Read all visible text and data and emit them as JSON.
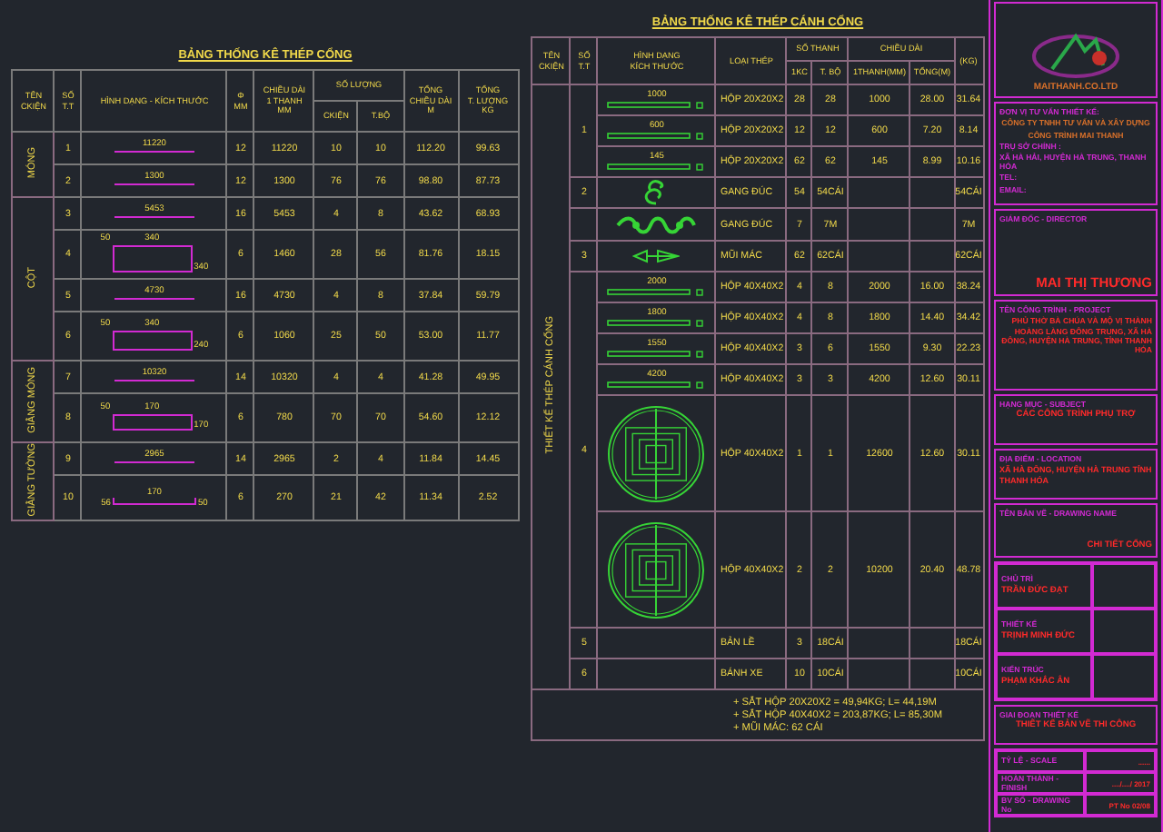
{
  "left_table": {
    "title": "BẢNG THỐNG KÊ THÉP CỔNG",
    "headers": {
      "name": "TÊN\nCKIỆN",
      "no": "SỐ\nT.T",
      "shape": "HÌNH DẠNG - KÍCH THƯỚC",
      "dia": "Φ\nMM",
      "length": "CHIỀU DÀI\n1 THANH\nMM",
      "qty": "SỐ LƯỢNG",
      "qty_part": "CKIỆN",
      "qty_total": "T.BỘ",
      "total_len": "TỔNG\nCHIỀU DÀI\nM",
      "weight": "TỔNG\nT. LƯỢNG\nKG"
    },
    "groups": [
      {
        "name": "MÓNG",
        "rows": [
          {
            "no": "1",
            "shape": {
              "kind": "bar",
              "dims": [
                "11220"
              ]
            },
            "dia": "12",
            "length": "11220",
            "part": "10",
            "total": "10",
            "total_len": "112.20",
            "weight": "99.63"
          },
          {
            "no": "2",
            "shape": {
              "kind": "bar",
              "dims": [
                "1300"
              ]
            },
            "dia": "12",
            "length": "1300",
            "part": "76",
            "total": "76",
            "total_len": "98.80",
            "weight": "87.73"
          }
        ]
      },
      {
        "name": "CỘT",
        "rows": [
          {
            "no": "3",
            "shape": {
              "kind": "bar",
              "dims": [
                "5453"
              ]
            },
            "dia": "16",
            "length": "5453",
            "part": "4",
            "total": "8",
            "total_len": "43.62",
            "weight": "68.93"
          },
          {
            "no": "4",
            "shape": {
              "kind": "stirrup",
              "dims": [
                "50",
                "340",
                "340"
              ]
            },
            "dia": "6",
            "length": "1460",
            "part": "28",
            "total": "56",
            "total_len": "81.76",
            "weight": "18.15"
          },
          {
            "no": "5",
            "shape": {
              "kind": "bar",
              "dims": [
                "4730"
              ]
            },
            "dia": "16",
            "length": "4730",
            "part": "4",
            "total": "8",
            "total_len": "37.84",
            "weight": "59.79"
          },
          {
            "no": "6",
            "shape": {
              "kind": "stirrup",
              "dims": [
                "50",
                "340",
                "240"
              ]
            },
            "dia": "6",
            "length": "1060",
            "part": "25",
            "total": "50",
            "total_len": "53.00",
            "weight": "11.77"
          }
        ]
      },
      {
        "name": "GIẰNG MÓNG",
        "rows": [
          {
            "no": "7",
            "shape": {
              "kind": "bar",
              "dims": [
                "10320"
              ]
            },
            "dia": "14",
            "length": "10320",
            "part": "4",
            "total": "4",
            "total_len": "41.28",
            "weight": "49.95"
          },
          {
            "no": "8",
            "shape": {
              "kind": "stirrup",
              "dims": [
                "50",
                "170",
                "170"
              ]
            },
            "dia": "6",
            "length": "780",
            "part": "70",
            "total": "70",
            "total_len": "54.60",
            "weight": "12.12"
          }
        ]
      },
      {
        "name": "GIẰNG TƯỜNG",
        "rows": [
          {
            "no": "9",
            "shape": {
              "kind": "bar",
              "dims": [
                "2965"
              ]
            },
            "dia": "14",
            "length": "2965",
            "part": "2",
            "total": "4",
            "total_len": "11.84",
            "weight": "14.45"
          },
          {
            "no": "10",
            "shape": {
              "kind": "hook",
              "dims": [
                "56",
                "170",
                "50"
              ]
            },
            "dia": "6",
            "length": "270",
            "part": "21",
            "total": "42",
            "total_len": "11.34",
            "weight": "2.52"
          }
        ]
      }
    ]
  },
  "gate_table": {
    "title": "BẢNG THỐNG KÊ THÉP CÁNH CỔNG",
    "headers": {
      "name": "TÊN\nCKIỆN",
      "no": "SỐ\nT.T",
      "shape": "HÌNH DẠNG\nKÍCH THƯỚC",
      "steel": "LOẠI THÉP",
      "count": "SỐ THANH",
      "count_part": "1KC",
      "count_total": "T. BỘ",
      "length": "CHIỀU DÀI",
      "length_one": "1THANH(MM)",
      "length_total": "TỔNG(M)",
      "weight": "(KG)"
    },
    "group_label": "THIẾT KẾ THÉP CÁNH CỔNG",
    "groups": [
      {
        "no": "1",
        "items": [
          {
            "shape": {
              "kind": "bar",
              "dims": [
                "1000"
              ]
            },
            "steel": "HỘP 20X20X2",
            "part": "28",
            "total": "28",
            "length": "1000",
            "total_m": "28.00",
            "weight": "31.64"
          },
          {
            "shape": {
              "kind": "bar",
              "dims": [
                "600"
              ]
            },
            "steel": "HỘP 20X20X2",
            "part": "12",
            "total": "12",
            "length": "600",
            "total_m": "7.20",
            "weight": "8.14"
          },
          {
            "shape": {
              "kind": "bar",
              "dims": [
                "145"
              ]
            },
            "steel": "HỘP 20X20X2",
            "part": "62",
            "total": "62",
            "length": "145",
            "total_m": "8.99",
            "weight": "10.16"
          }
        ]
      },
      {
        "no": "2",
        "items": [
          {
            "shape": {
              "kind": "swirl"
            },
            "steel": "GANG ĐÚC",
            "part": "54",
            "total": "54CÁI",
            "weight": "54CÁI"
          }
        ]
      },
      {
        "items": [
          {
            "shape": {
              "kind": "vine"
            },
            "steel": "GANG ĐÚC",
            "part": "7",
            "total": "7M",
            "weight": "7M"
          }
        ]
      },
      {
        "no": "3",
        "items": [
          {
            "shape": {
              "kind": "spear"
            },
            "steel": "MŨI MÁC",
            "part": "62",
            "total": "62CÁI",
            "weight": "62CÁI"
          }
        ]
      },
      {
        "no": "4",
        "items": [
          {
            "shape": {
              "kind": "bar",
              "dims": [
                "2000"
              ]
            },
            "steel": "HỘP 40X40X2",
            "part": "4",
            "total": "8",
            "length": "2000",
            "total_m": "16.00",
            "weight": "38.24"
          },
          {
            "shape": {
              "kind": "bar",
              "dims": [
                "1800"
              ]
            },
            "steel": "HỘP 40X40X2",
            "part": "4",
            "total": "8",
            "length": "1800",
            "total_m": "14.40",
            "weight": "34.42"
          },
          {
            "shape": {
              "kind": "bar",
              "dims": [
                "1550"
              ]
            },
            "steel": "HỘP 40X40X2",
            "part": "3",
            "total": "6",
            "length": "1550",
            "total_m": "9.30",
            "weight": "22.23"
          },
          {
            "shape": {
              "kind": "bar",
              "dims": [
                "4200"
              ]
            },
            "steel": "HỘP 40X40X2",
            "part": "3",
            "total": "3",
            "length": "4200",
            "total_m": "12.60",
            "weight": "30.11"
          },
          {
            "shape": {
              "kind": "medallion"
            },
            "steel": "HỘP 40X40X2",
            "part": "1",
            "total": "1",
            "length": "12600",
            "total_m": "12.60",
            "weight": "30.11"
          },
          {
            "shape": {
              "kind": "medallion"
            },
            "steel": "HỘP 40X40X2",
            "part": "2",
            "total": "2",
            "length": "10200",
            "total_m": "20.40",
            "weight": "48.78"
          }
        ]
      },
      {
        "no": "5",
        "items": [
          {
            "shape": {
              "kind": "none"
            },
            "steel": "BẢN LỀ",
            "part": "3",
            "total": "18CÁI",
            "weight": "18CÁI"
          }
        ]
      },
      {
        "no": "6",
        "items": [
          {
            "shape": {
              "kind": "none"
            },
            "steel": "BÁNH XE",
            "part": "10",
            "total": "10CÁI",
            "weight": "10CÁI"
          }
        ]
      }
    ],
    "notes": [
      "+ SẮT HỘP 20X20X2 = 49,94KG; L= 44,19M",
      "+ SẮT HỘP 40X40X2 = 203,87KG; L= 85,30M",
      "+ MŨI MÁC: 62 CÁI"
    ]
  },
  "title_block": {
    "logo_text": "MAITHANH.CO.LTD",
    "consultant": {
      "label": "ĐƠN VỊ TƯ VẤN THIẾT KẾ:",
      "company": [
        "CÔNG TY TNHH TƯ VẤN VÀ XÂY DỰNG",
        "CÔNG TRÌNH MAI THANH"
      ],
      "office_label": "TRỤ SỞ CHÍNH :",
      "details": [
        "XÃ HÀ HẢI, HUYỆN HÀ TRUNG, THANH HÓA",
        "TEL:",
        "EMAIL:"
      ]
    },
    "director": {
      "label": "GIÁM ĐỐC - DIRECTOR",
      "value": "MAI THỊ THƯƠNG"
    },
    "project": {
      "label": "TÊN CÔNG TRÌNH - PROJECT",
      "value": "PHỦ THỜ BÀ CHÚA VÀ MỘ VỊ THÀNH HOÀNG LÀNG ĐÔNG TRUNG, XÃ HÀ ĐÔNG, HUYỆN HÀ TRUNG, TỈNH THANH HÓA"
    },
    "subject": {
      "label": "HẠNG MỤC - SUBJECT",
      "value": "CÁC CÔNG TRÌNH PHỤ TRỢ"
    },
    "location": {
      "label": "ĐỊA ĐIỂM - LOCATION",
      "value": "XÃ HÀ ĐÔNG, HUYỆN HÀ TRUNG TỈNH THANH HÓA"
    },
    "drawing_name": {
      "label": "TÊN BẢN VẼ - DRAWING NAME",
      "value": "CHI TIẾT CỔNG"
    },
    "staff": [
      {
        "role": "CHỦ TRÌ",
        "name": "TRẦN ĐỨC ĐẠT"
      },
      {
        "role": "THIẾT KẾ",
        "name": "TRỊNH MINH ĐỨC"
      },
      {
        "role": "KIẾN TRÚC",
        "name": "PHẠM KHẮC ÂN"
      }
    ],
    "phase": {
      "label": "GIAI ĐOẠN THIẾT KẾ",
      "value": "THIẾT KẾ BẢN VẼ THI CÔNG"
    },
    "meta": [
      {
        "label": "TỶ LỆ - SCALE",
        "value": "......"
      },
      {
        "label": "HOÀN THÀNH - FINISH",
        "value": "..../..../ 2017"
      },
      {
        "label": "BV SỐ - DRAWING No",
        "value": "PT No 02/08"
      }
    ]
  }
}
